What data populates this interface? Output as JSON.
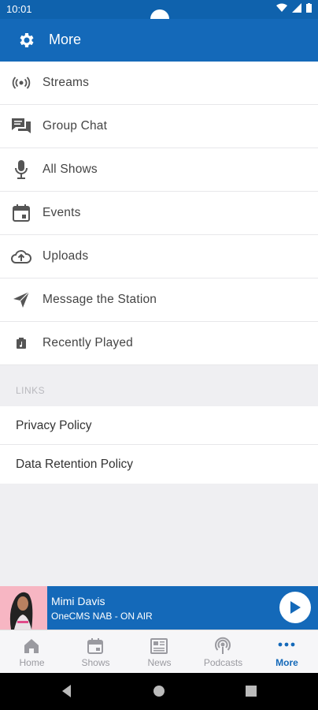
{
  "status": {
    "time": "10:01"
  },
  "header": {
    "title": "More"
  },
  "menu": {
    "items": [
      {
        "label": "Streams",
        "icon": "radio-waves-icon"
      },
      {
        "label": "Group Chat",
        "icon": "chat-bubbles-icon"
      },
      {
        "label": "All Shows",
        "icon": "microphone-icon"
      },
      {
        "label": "Events",
        "icon": "calendar-icon"
      },
      {
        "label": "Uploads",
        "icon": "cloud-upload-icon"
      },
      {
        "label": "Message the Station",
        "icon": "send-icon"
      },
      {
        "label": "Recently Played",
        "icon": "music-note-icon"
      }
    ]
  },
  "links": {
    "header": "LINKS",
    "items": [
      {
        "label": "Privacy Policy"
      },
      {
        "label": "Data Retention Policy"
      }
    ]
  },
  "player": {
    "name": "Mimi Davis",
    "station": "OneCMS NAB - ON AIR"
  },
  "tabs": [
    {
      "label": "Home",
      "icon": "home-icon"
    },
    {
      "label": "Shows",
      "icon": "calendar-icon"
    },
    {
      "label": "News",
      "icon": "newspaper-icon"
    },
    {
      "label": "Podcasts",
      "icon": "podcast-icon"
    },
    {
      "label": "More",
      "icon": "more-dots-icon",
      "active": true
    }
  ],
  "colors": {
    "brand": "#1469b9",
    "statusbar": "#0f62ad",
    "background": "#efeff2"
  }
}
